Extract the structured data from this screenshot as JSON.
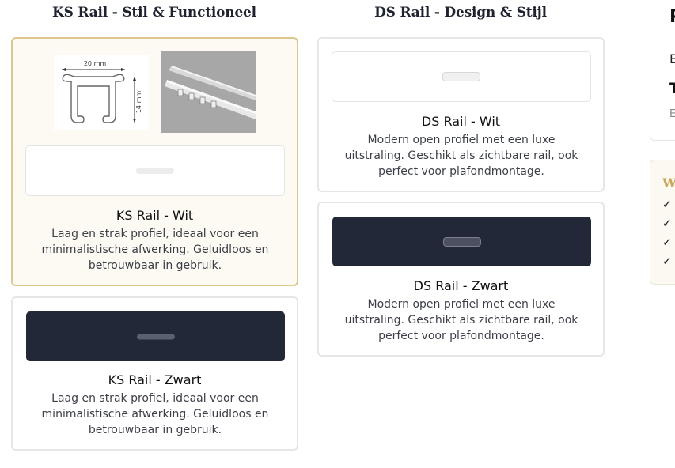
{
  "columns": [
    {
      "title": "KS Rail - Stil & Functioneel",
      "cards": [
        {
          "title": "KS Rail - Wit",
          "description": "Laag en strak profiel, ideaal voor een minimalistische afwerking. Geluidloos en betrouwbaar in gebruik.",
          "variant": "white",
          "selected": true,
          "diagram": {
            "width_label": "20 mm",
            "height_label": "14 mm"
          }
        },
        {
          "title": "KS Rail - Zwart",
          "description": "Laag en strak profiel, ideaal voor een minimalistische afwerking. Geluidloos en betrouwbaar in gebruik.",
          "variant": "black",
          "selected": false
        }
      ]
    },
    {
      "title": "DS Rail - Design & Stijl",
      "cards": [
        {
          "title": "DS Rail - Wit",
          "description": "Modern open profiel met een luxe uitstraling. Geschikt als zichtbare rail, ook perfect voor plafondmontage.",
          "variant": "white",
          "selected": false
        },
        {
          "title": "DS Rail - Zwart",
          "description": "Modern open profiel met een luxe uitstraling. Geschikt als zichtbare rail, ook perfect voor plafondmontage.",
          "variant": "black",
          "selected": false
        }
      ]
    }
  ],
  "right_panel": {
    "heading_partial": "P",
    "line1_partial": "B",
    "line2_partial": "T",
    "line3_partial": "E",
    "box_title_partial": "W",
    "checks": [
      "✓",
      "✓",
      "✓",
      "✓"
    ]
  },
  "colors": {
    "selected_border": "#dcc88f",
    "selected_bg": "#fcfaf3",
    "dark_rail": "#222838",
    "accent_gold": "#c9a85c"
  }
}
